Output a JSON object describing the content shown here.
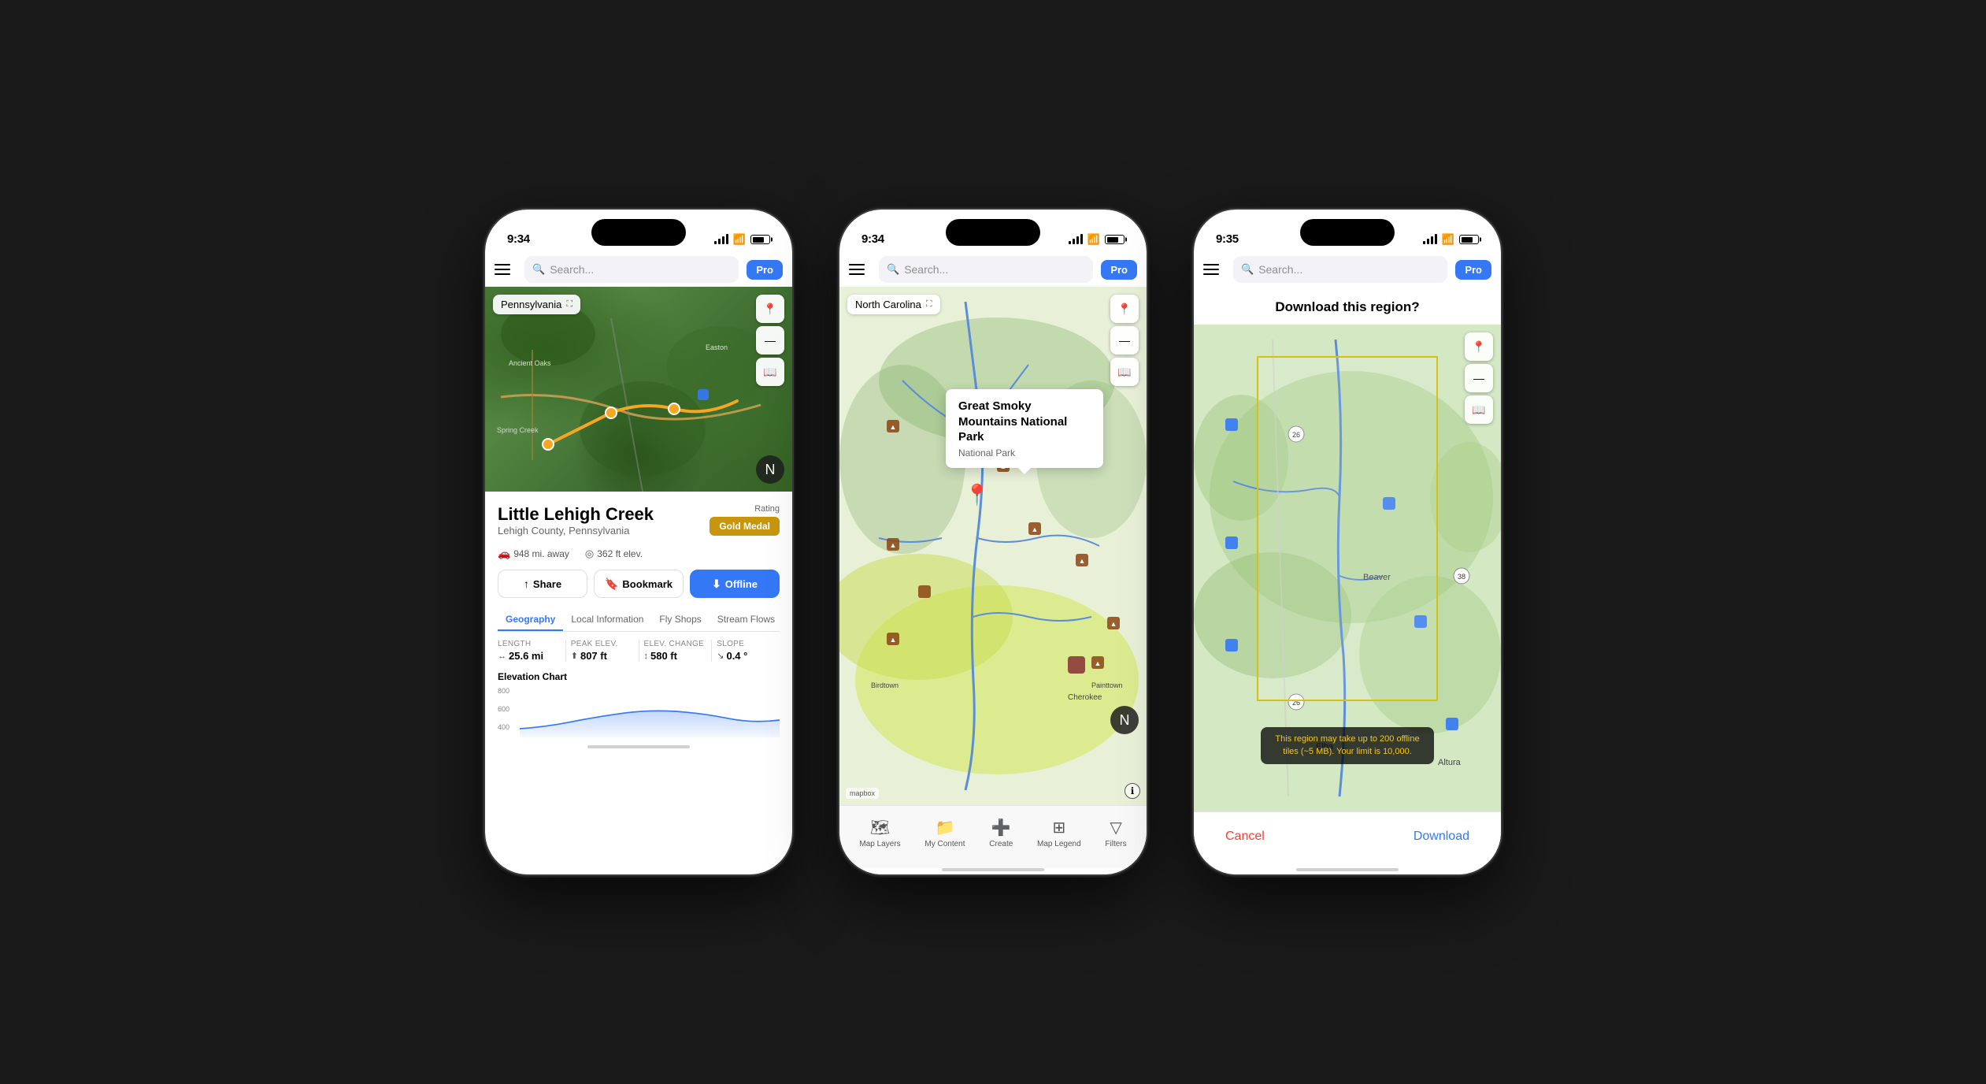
{
  "phone1": {
    "status": {
      "time": "9:34",
      "time_arrow": "◂",
      "signal": "●●●",
      "wifi": "WiFi",
      "battery": "Battery"
    },
    "searchbar": {
      "placeholder": "Search...",
      "pro_label": "Pro"
    },
    "map": {
      "location_label": "Pennsylvania"
    },
    "info": {
      "trail_name": "Little Lehigh Creek",
      "location": "Lehigh County, Pennsylvania",
      "distance": "948 mi. away",
      "elevation": "362 ft elev.",
      "rating_label": "Rating",
      "rating_value": "Gold Medal",
      "share_label": "Share",
      "bookmark_label": "Bookmark",
      "offline_label": "Offline",
      "tabs": [
        "Geography",
        "Local Information",
        "Fly Shops",
        "Stream Flows"
      ],
      "stats": [
        {
          "label": "Length",
          "icon": "↔",
          "value": "25.6 mi"
        },
        {
          "label": "Peak Elev.",
          "icon": "⬆",
          "value": "807 ft"
        },
        {
          "label": "Elev. Change",
          "icon": "↕",
          "value": "580 ft"
        },
        {
          "label": "Slope",
          "icon": "↘",
          "value": "0.4 °"
        }
      ],
      "elevation_chart_label": "Elevation Chart",
      "elevation_values": [
        "800",
        "600",
        "400"
      ]
    }
  },
  "phone2": {
    "status": {
      "time": "9:34"
    },
    "searchbar": {
      "placeholder": "Search...",
      "pro_label": "Pro"
    },
    "map": {
      "location_label": "North Carolina"
    },
    "popup": {
      "title": "Great Smoky Mountains National Park",
      "subtitle": "National Park"
    },
    "bottomnav": [
      {
        "icon": "🗺",
        "label": "Map Layers"
      },
      {
        "icon": "📁",
        "label": "My Content"
      },
      {
        "icon": "➕",
        "label": "Create"
      },
      {
        "icon": "⬛",
        "label": "Map Legend"
      },
      {
        "icon": "▽",
        "label": "Filters"
      }
    ]
  },
  "phone3": {
    "status": {
      "time": "9:35"
    },
    "searchbar": {
      "placeholder": "Search...",
      "pro_label": "Pro"
    },
    "header": {
      "title": "Download this region?"
    },
    "warning": {
      "text": "This region may take up to 200 offline tiles (~5 MB). Your limit is 10,000."
    },
    "footer": {
      "cancel_label": "Cancel",
      "download_label": "Download"
    }
  }
}
